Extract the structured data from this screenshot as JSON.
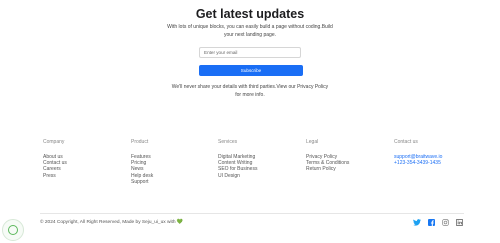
{
  "newsletter": {
    "title": "Get latest updates",
    "description": "With lots of unique blocks, you can easily build a page without coding.Build your next landing page.",
    "email_placeholder": "Enter your email",
    "subscribe_label": "Subscribe",
    "privacy_note": "We'll never share your details with third parties.View our Privacy Policy for more info."
  },
  "footer": {
    "columns": [
      {
        "title": "Company",
        "links": [
          "About us",
          "Contact us",
          "Careers",
          "Press"
        ]
      },
      {
        "title": "Product",
        "links": [
          "Features",
          "Pricing",
          "News",
          "Help desk",
          "Support"
        ]
      },
      {
        "title": "Services",
        "links": [
          "Digital Marketing",
          "Content Writing",
          "SEO for Business",
          "UI Design"
        ]
      },
      {
        "title": "Legal",
        "links": [
          "Privacy Policy",
          "Terms & Conditions",
          "Return Policy"
        ]
      },
      {
        "title": "Contact us",
        "links": [
          "support@braitwave.io",
          "+123-354-3439-1435"
        ]
      }
    ],
    "copyright": "© 2024 Copyright, All Right Reserved, Made by Seju_ui_ux with",
    "heart": "💚",
    "socials": [
      "twitter-icon",
      "facebook-icon",
      "instagram-icon",
      "linkedin-icon"
    ],
    "colors": {
      "accent": "#1a6ef5",
      "twitter": "#1da1f2",
      "facebook": "#1877f2",
      "instagram": "#888888",
      "linkedin": "#555555"
    }
  }
}
